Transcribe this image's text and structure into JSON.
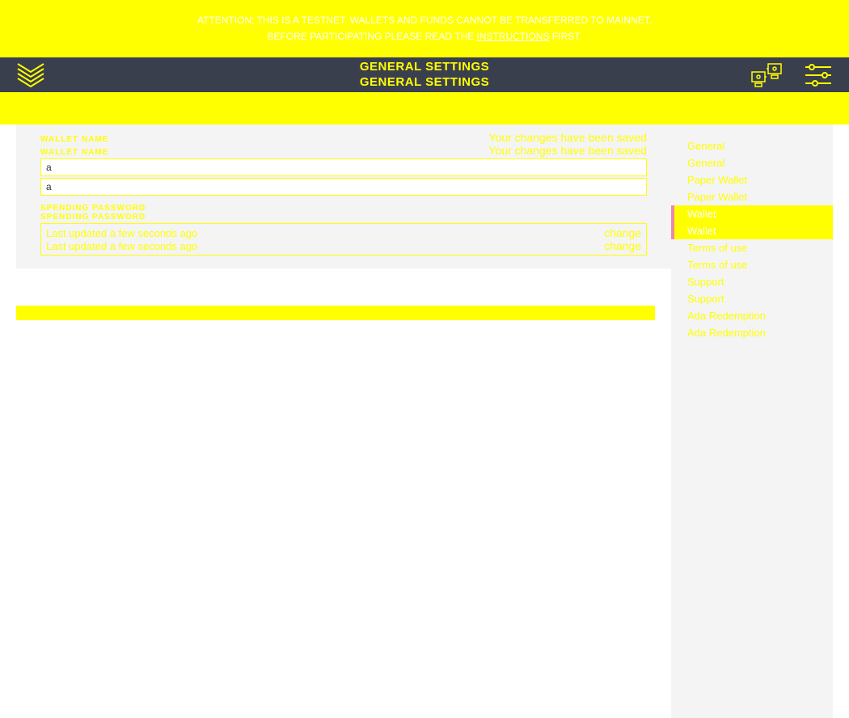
{
  "banner": {
    "line1": "ATTENTION: THIS IS A TESTNET. WALLETS AND FUNDS CANNOT BE TRANSFERRED TO MAINNET.",
    "line2_prefix": "BEFORE PARTICIPATING PLEASE READ THE ",
    "line2_link": "INSTRUCTIONS",
    "line2_suffix": " FIRST."
  },
  "topbar": {
    "title1": "GENERAL SETTINGS",
    "title2": "GENERAL SETTINGS"
  },
  "panel": {
    "wallet_name_label1": "WALLET NAME",
    "wallet_name_label2": "WALLET NAME",
    "saved1": "Your changes have been saved",
    "saved2": "Your changes have been saved",
    "value1": "a",
    "value2": "a",
    "pw_label1": "SPENDING PASSWORD",
    "pw_label2": "SPENDING PASSWORD",
    "pw_updated1": "Last updated a few seconds ago",
    "pw_updated2": "Last updated a few seconds ago",
    "change1": "change",
    "change2": "change"
  },
  "sidebar": {
    "items": [
      {
        "label": "General",
        "active": false
      },
      {
        "label": "General",
        "active": false
      },
      {
        "label": "Paper Wallet",
        "active": false
      },
      {
        "label": "Paper Wallet",
        "active": false
      },
      {
        "label": "Wallet",
        "active": true
      },
      {
        "label": "Wallet",
        "active": true
      },
      {
        "label": "Terms of use",
        "active": false
      },
      {
        "label": "Terms of use",
        "active": false
      },
      {
        "label": "Support",
        "active": false
      },
      {
        "label": "Support",
        "active": false
      },
      {
        "label": "Ada Redemption",
        "active": false
      },
      {
        "label": "Ada Redemption",
        "active": false
      }
    ]
  }
}
